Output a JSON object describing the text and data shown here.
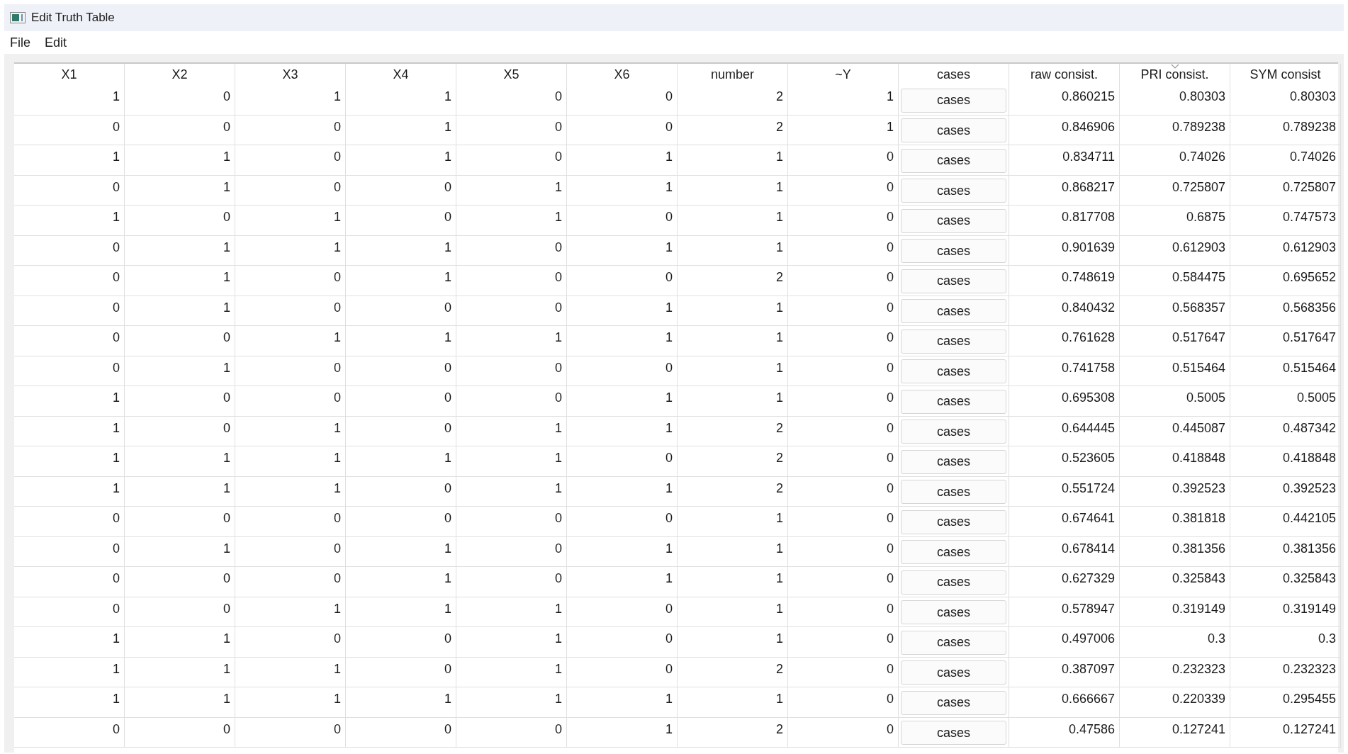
{
  "window": {
    "title": "Edit Truth Table"
  },
  "menu": [
    "File",
    "Edit"
  ],
  "table": {
    "columns": [
      {
        "label": "X1",
        "kind": "text",
        "sorted": false
      },
      {
        "label": "X2",
        "kind": "text",
        "sorted": false
      },
      {
        "label": "X3",
        "kind": "text",
        "sorted": false
      },
      {
        "label": "X4",
        "kind": "text",
        "sorted": false
      },
      {
        "label": "X5",
        "kind": "text",
        "sorted": false
      },
      {
        "label": "X6",
        "kind": "text",
        "sorted": false
      },
      {
        "label": "number",
        "kind": "text",
        "sorted": false
      },
      {
        "label": "~Y",
        "kind": "text",
        "sorted": false
      },
      {
        "label": "cases",
        "kind": "button",
        "sorted": false
      },
      {
        "label": "raw consist.",
        "kind": "text",
        "sorted": false
      },
      {
        "label": "PRI consist.",
        "kind": "text",
        "sorted": true
      },
      {
        "label": "SYM consist",
        "kind": "text",
        "sorted": false
      }
    ],
    "rows": [
      [
        "1",
        "0",
        "1",
        "1",
        "0",
        "0",
        "2",
        "1",
        "cases",
        "0.860215",
        "0.80303",
        "0.80303"
      ],
      [
        "0",
        "0",
        "0",
        "1",
        "0",
        "0",
        "2",
        "1",
        "cases",
        "0.846906",
        "0.789238",
        "0.789238"
      ],
      [
        "1",
        "1",
        "0",
        "1",
        "0",
        "1",
        "1",
        "0",
        "cases",
        "0.834711",
        "0.74026",
        "0.74026"
      ],
      [
        "0",
        "1",
        "0",
        "0",
        "1",
        "1",
        "1",
        "0",
        "cases",
        "0.868217",
        "0.725807",
        "0.725807"
      ],
      [
        "1",
        "0",
        "1",
        "0",
        "1",
        "0",
        "1",
        "0",
        "cases",
        "0.817708",
        "0.6875",
        "0.747573"
      ],
      [
        "0",
        "1",
        "1",
        "1",
        "0",
        "1",
        "1",
        "0",
        "cases",
        "0.901639",
        "0.612903",
        "0.612903"
      ],
      [
        "0",
        "1",
        "0",
        "1",
        "0",
        "0",
        "2",
        "0",
        "cases",
        "0.748619",
        "0.584475",
        "0.695652"
      ],
      [
        "0",
        "1",
        "0",
        "0",
        "0",
        "1",
        "1",
        "0",
        "cases",
        "0.840432",
        "0.568357",
        "0.568356"
      ],
      [
        "0",
        "0",
        "1",
        "1",
        "1",
        "1",
        "1",
        "0",
        "cases",
        "0.761628",
        "0.517647",
        "0.517647"
      ],
      [
        "0",
        "1",
        "0",
        "0",
        "0",
        "0",
        "1",
        "0",
        "cases",
        "0.741758",
        "0.515464",
        "0.515464"
      ],
      [
        "1",
        "0",
        "0",
        "0",
        "0",
        "1",
        "1",
        "0",
        "cases",
        "0.695308",
        "0.5005",
        "0.5005"
      ],
      [
        "1",
        "0",
        "1",
        "0",
        "1",
        "1",
        "2",
        "0",
        "cases",
        "0.644445",
        "0.445087",
        "0.487342"
      ],
      [
        "1",
        "1",
        "1",
        "1",
        "1",
        "0",
        "2",
        "0",
        "cases",
        "0.523605",
        "0.418848",
        "0.418848"
      ],
      [
        "1",
        "1",
        "1",
        "0",
        "1",
        "1",
        "2",
        "0",
        "cases",
        "0.551724",
        "0.392523",
        "0.392523"
      ],
      [
        "0",
        "0",
        "0",
        "0",
        "0",
        "0",
        "1",
        "0",
        "cases",
        "0.674641",
        "0.381818",
        "0.442105"
      ],
      [
        "0",
        "1",
        "0",
        "1",
        "0",
        "1",
        "1",
        "0",
        "cases",
        "0.678414",
        "0.381356",
        "0.381356"
      ],
      [
        "0",
        "0",
        "0",
        "1",
        "0",
        "1",
        "1",
        "0",
        "cases",
        "0.627329",
        "0.325843",
        "0.325843"
      ],
      [
        "0",
        "0",
        "1",
        "1",
        "1",
        "0",
        "1",
        "0",
        "cases",
        "0.578947",
        "0.319149",
        "0.319149"
      ],
      [
        "1",
        "1",
        "0",
        "0",
        "1",
        "0",
        "1",
        "0",
        "cases",
        "0.497006",
        "0.3",
        "0.3"
      ],
      [
        "1",
        "1",
        "1",
        "0",
        "1",
        "0",
        "2",
        "0",
        "cases",
        "0.387097",
        "0.232323",
        "0.232323"
      ],
      [
        "1",
        "1",
        "1",
        "1",
        "1",
        "1",
        "1",
        "0",
        "cases",
        "0.666667",
        "0.220339",
        "0.295455"
      ],
      [
        "0",
        "0",
        "0",
        "0",
        "0",
        "1",
        "2",
        "0",
        "cases",
        "0.47586",
        "0.127241",
        "0.127241"
      ]
    ]
  }
}
